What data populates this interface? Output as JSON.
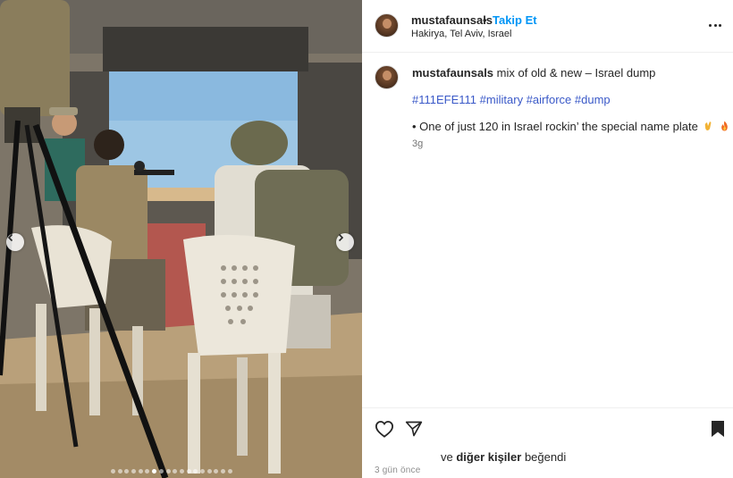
{
  "post": {
    "username": "mustafaunsals",
    "separator": "•",
    "follow_label": "Takip Et",
    "location": "Hakirya, Tel Aviv, Israel",
    "caption_username": "mustafaunsals",
    "caption_text": " mix of old & new – Israel dump",
    "hashtags": [
      "#111EFE111",
      "#military",
      "#airforce",
      "#dump"
    ],
    "note_text": "• One of just 120 in Israel rockin’ the special name plate",
    "note_emojis": [
      "ok-hand-emoji",
      "fire-emoji"
    ],
    "comment_time": "3g",
    "likes_prefix": "ve ",
    "likes_bold": "diğer kişiler",
    "likes_suffix": " beğendi",
    "posted_time": "3 gün önce"
  },
  "carousel": {
    "total_slides": 18,
    "active_index": 6
  },
  "icons": {
    "more": "more-options-icon",
    "prev": "chevron-left-icon",
    "next": "chevron-right-icon",
    "like": "heart-icon",
    "share": "send-icon",
    "save": "bookmark-icon"
  },
  "colors": {
    "link_blue": "#0095f6",
    "hashtag_blue": "#3a59c8",
    "text": "#262626",
    "muted": "#737373"
  }
}
